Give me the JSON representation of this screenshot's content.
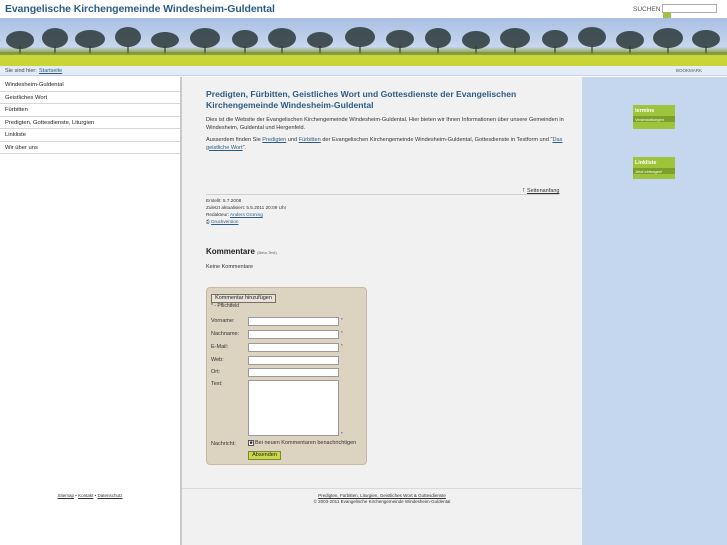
{
  "header": {
    "site_title": "Evangelische Kirchengemeinde Windesheim-Guldental",
    "search_label": "SUCHEN"
  },
  "breadcrumb": {
    "label": "Sie sind hier:",
    "link": "Startseite",
    "tools": "BOOKMARK"
  },
  "nav": {
    "items": [
      {
        "label": "Windesheim-Guldental"
      },
      {
        "label": "Geistliches Wort"
      },
      {
        "label": "Fürbitten"
      },
      {
        "label": "Predigten, Gottesdienste, Liturgien"
      },
      {
        "label": "Linkliste"
      },
      {
        "label": "Wir über uns"
      }
    ],
    "footer": {
      "sitemap": "Sitemap",
      "sep1": " • ",
      "kontakt": "Kontakt",
      "sep2": " • ",
      "datenschutz": "Datenschutz"
    }
  },
  "main": {
    "title": "Predigten, Fürbitten, Geistliches Wort und Gottesdienste der Evangelischen Kirchengemeinde Windesheim-Guldental",
    "para1": "Dies ist die Website der Evangelischen Kirchengemeinde Windesheim-Guldental. Hier bieten wir Ihnen Informationen über unsere Gemeinden in Windesheim, Guldental und Hergenfeld.",
    "para2_pre": "Ausserdem finden Sie ",
    "para2_link1": "Predigten",
    "para2_mid1": " und ",
    "para2_link2": "Fürbitten",
    "para2_mid2": " der Evangelischen Kirchengemeinde Windesheim-Guldental, Gottesdienste in Textform und \"",
    "para2_link3": "Das geistliche Wort",
    "para2_end": "\".",
    "top_link": "Seitenanfang",
    "meta": {
      "created": "Erstellt: 5.7.2008",
      "updated": "Zuletzt aktualisiert: 5.5.2011 20:09 Uhr",
      "editor_label": "Redakteur: ",
      "editor": "Anders Grüning",
      "print": "Druckversion"
    },
    "comments_title": "Kommentare",
    "comments_beta": "(Beta-Test)",
    "no_comments": "Keine Kommentare",
    "footer": {
      "link": "Predigten, Fürbitten, Liturgien, Geistliches Wort & Gottesdienste",
      "copyright": "© 2003-2011 Evangelische Kirchengemeinde Windesheim-Guldental"
    }
  },
  "form": {
    "add_button": "Kommentar hinzufügen",
    "required_note": "* - Pflichtfeld",
    "fields": [
      {
        "label": "Vorname:",
        "required": "*"
      },
      {
        "label": "Nachname:",
        "required": "*"
      },
      {
        "label": "E-Mail:",
        "required": "*"
      },
      {
        "label": "Web:",
        "required": ""
      },
      {
        "label": "Ort:",
        "required": ""
      }
    ],
    "text_label": "Text:",
    "text_required": "*",
    "notify_label": "Nachricht:",
    "notify_checkbox": "Bei neuen Kommentaren benachrichtigen",
    "submit": "Absenden"
  },
  "sidebar": {
    "teaser1_title": "termine",
    "teaser1_sub": "Veranstaltungen",
    "teaser2_title": "Linkliste",
    "teaser2_sub": "Jetzt eintragen!"
  },
  "colors": {
    "brand_blue": "#2c5d86",
    "accent_green": "#9ec43c",
    "sidebar_blue": "#c5d7ef"
  }
}
